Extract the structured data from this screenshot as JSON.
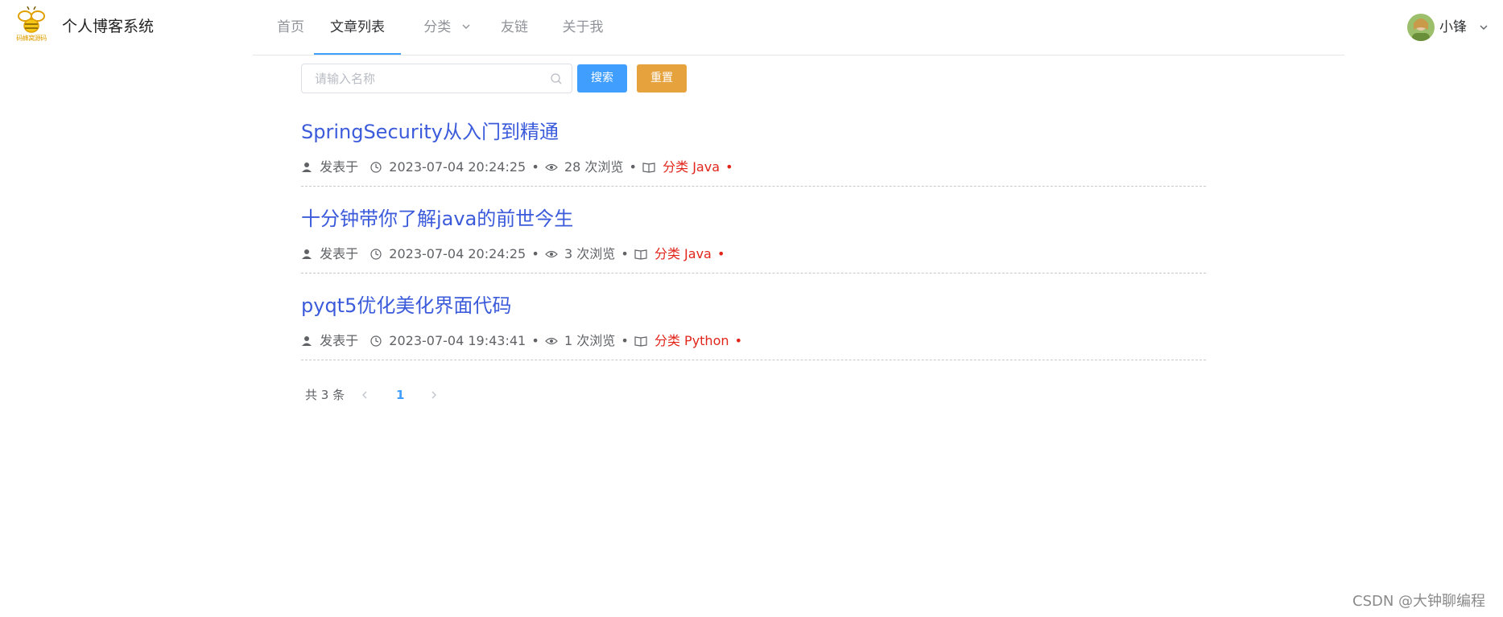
{
  "header": {
    "logo_caption": "码蜂窝源码",
    "site_title": "个人博客系统",
    "nav": [
      {
        "label": "首页"
      },
      {
        "label": "文章列表"
      },
      {
        "label": "分类"
      },
      {
        "label": "友链"
      },
      {
        "label": "关于我"
      }
    ],
    "user_name": "小锋"
  },
  "search": {
    "placeholder": "请输入名称",
    "search_label": "搜索",
    "reset_label": "重置"
  },
  "articles": [
    {
      "title": "SpringSecurity从入门到精通",
      "author_label": "发表于",
      "datetime": "2023-07-04 20:24:25",
      "views": "28 次浏览",
      "category": "分类 Java"
    },
    {
      "title": "十分钟带你了解java的前世今生",
      "author_label": "发表于",
      "datetime": "2023-07-04 20:24:25",
      "views": "3 次浏览",
      "category": "分类 Java"
    },
    {
      "title": "pyqt5优化美化界面代码",
      "author_label": "发表于",
      "datetime": "2023-07-04 19:43:41",
      "views": "1 次浏览",
      "category": "分类 Python"
    }
  ],
  "pagination": {
    "total": "共 3 条",
    "current": "1"
  },
  "watermark": "CSDN @大钟聊编程",
  "colors": {
    "accent": "#409eff",
    "reset": "#e6a23c",
    "title_link": "#3b5bdb",
    "category": "#e1251b"
  }
}
